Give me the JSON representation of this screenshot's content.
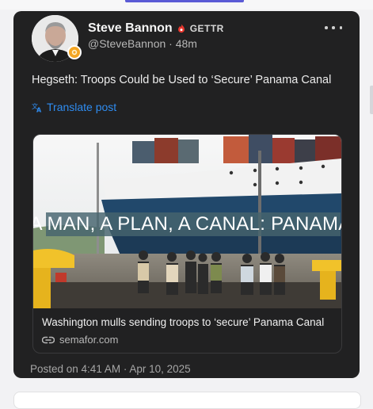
{
  "post": {
    "author": {
      "display_name": "Steve Bannon",
      "verified_icon": "flame-verified-icon",
      "platform_label": "GETTR",
      "handle": "@SteveBannon",
      "age": "48m"
    },
    "text": "Hegseth: Troops Could be Used to ‘Secure’ Panama Canal",
    "translate_label": "Translate post",
    "link_preview": {
      "image_overlay_text": "A MAN, A PLAN, A CANAL: PANAMA!",
      "title": "Washington mulls sending troops to ‘secure’ Panama Canal",
      "domain": "semafor.com"
    },
    "posted_on": "Posted on 4:41 AM · Apr 10, 2025"
  },
  "colors": {
    "card_background": "#212122",
    "link_blue": "#2f8cf0",
    "brand_red": "#e8382f",
    "page_background": "#f2f2f4"
  }
}
